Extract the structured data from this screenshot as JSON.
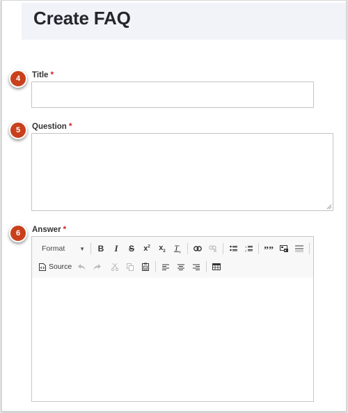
{
  "page": {
    "title": "Create FAQ"
  },
  "fields": [
    {
      "step": "4",
      "label": "Title",
      "required_mark": "*",
      "value": "",
      "type": "text"
    },
    {
      "step": "5",
      "label": "Question",
      "required_mark": "*",
      "value": "",
      "type": "textarea"
    },
    {
      "step": "6",
      "label": "Answer",
      "required_mark": "*",
      "value": "",
      "type": "rich-text"
    }
  ],
  "editor": {
    "format_label": "Format",
    "source_label": "Source",
    "toolbar_row1": [
      "bold-icon",
      "italic-icon",
      "strikethrough-icon",
      "superscript-icon",
      "subscript-icon",
      "remove-format-icon",
      "link-icon",
      "unlink-icon",
      "bulleted-list-icon",
      "numbered-list-icon",
      "blockquote-icon",
      "image-icon",
      "horizontal-rule-icon"
    ],
    "toolbar_row2": [
      "undo-icon",
      "redo-icon",
      "cut-icon",
      "copy-icon",
      "paste-icon",
      "align-left-icon",
      "align-center-icon",
      "align-right-icon",
      "table-icon"
    ]
  },
  "colors": {
    "step_badge": "#c9401c",
    "required": "#d0202a",
    "header_bg": "#f2f3f8"
  }
}
